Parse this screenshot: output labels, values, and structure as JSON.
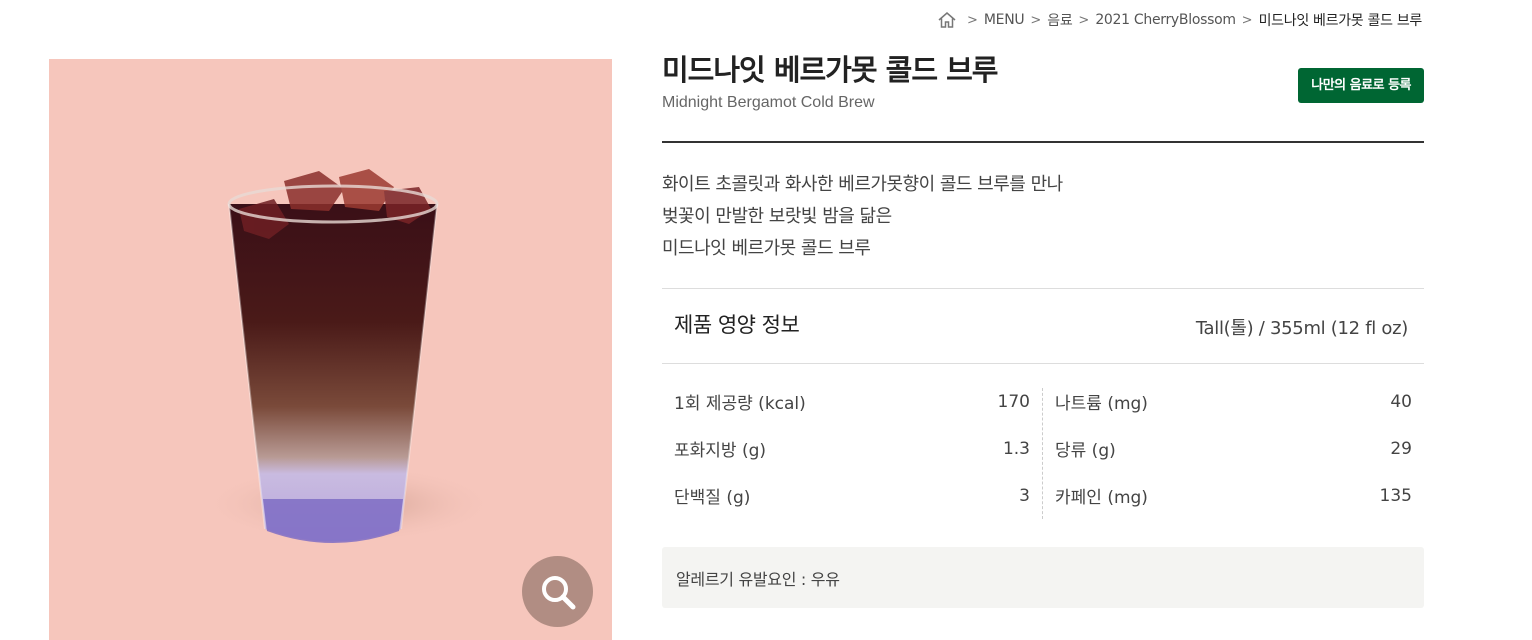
{
  "breadcrumb": {
    "items": [
      "MENU",
      "음료",
      "2021 CherryBlossom"
    ],
    "current": "미드나잇 베르가못 콜드 브루"
  },
  "product": {
    "title_ko": "미드나잇 베르가못 콜드 브루",
    "title_en": "Midnight Bergamot Cold Brew",
    "register_label": "나만의 음료로 등록",
    "description_lines": [
      "화이트 초콜릿과 화사한 베르가못향이 콜드 브루를 만나",
      "벚꽃이 만발한 보랏빛 밤을 닮은",
      "미드나잇 베르가못 콜드 브루"
    ]
  },
  "nutrition": {
    "title": "제품 영양 정보",
    "serving_size": "Tall(톨) / 355ml (12 fl oz)",
    "left": [
      {
        "label": "1회 제공량 (kcal)",
        "value": "170"
      },
      {
        "label": "포화지방 (g)",
        "value": "1.3"
      },
      {
        "label": "단백질 (g)",
        "value": "3"
      }
    ],
    "right": [
      {
        "label": "나트륨 (mg)",
        "value": "40"
      },
      {
        "label": "당류 (g)",
        "value": "29"
      },
      {
        "label": "카페인 (mg)",
        "value": "135"
      }
    ]
  },
  "allergy": {
    "text": "알레르기 유발요인 : 우유"
  },
  "colors": {
    "brand_green": "#006633",
    "image_background": "#f6c6bc",
    "allergy_background": "#f4f4f2"
  },
  "icons": {
    "home": "home-icon",
    "zoom": "magnifier-icon"
  }
}
